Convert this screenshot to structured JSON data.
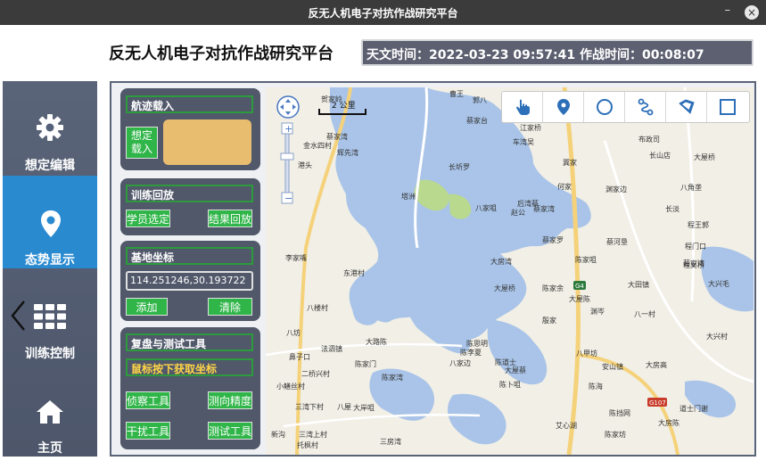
{
  "window": {
    "title": "反无人机电子对抗作战研究平台",
    "minimize": "–",
    "close": "×"
  },
  "header": {
    "title": "反无人机电子对抗作战研究平台",
    "astro_label": "天文时间：",
    "astro_time": "2022-03-23 09:57:41",
    "combat_label": "作战时间：",
    "combat_time": "00:08:07"
  },
  "sidebar": {
    "items": [
      {
        "label": "想定编辑",
        "icon": "gear-icon"
      },
      {
        "label": "态势显示",
        "icon": "location-pin-icon"
      },
      {
        "label": "训练控制",
        "icon": "grid-icon"
      },
      {
        "label": "主页",
        "icon": "home-icon"
      }
    ],
    "active_index": 1
  },
  "panels": {
    "track": {
      "title": "航迹载入",
      "button": "想定\n载入"
    },
    "replay": {
      "title": "训练回放",
      "left_button": "学员选定",
      "right_button": "结果回放"
    },
    "base": {
      "title": "基地坐标",
      "value": "114.251246,30.193722",
      "add_button": "添加",
      "clear_button": "清除"
    },
    "tools": {
      "title": "复盘与测试工具",
      "hint": "鼠标按下获取坐标",
      "btn1": "侦察工具",
      "btn2": "测向精度",
      "btn3": "干扰工具",
      "btn4": "测试工具"
    }
  },
  "map": {
    "scale_label": "2 公里",
    "road_label": "G4",
    "road_label2": "G107",
    "places": [
      "曹王",
      "郭八",
      "贺家岭",
      "蔡家台",
      "江家桥",
      "车湾吴",
      "金水四村",
      "蔡家湾",
      "港头",
      "辉先湾",
      "长圻罗",
      "冀家",
      "布政司",
      "长山店",
      "大屋桥",
      "何家",
      "渊家边",
      "八角垄",
      "塔洲",
      "八家咀",
      "后湾蔡",
      "赵公",
      "蔡家湾",
      "长淡",
      "程王郭",
      "蔡家罗",
      "程门口",
      "蔡河垦",
      "蔡家湾",
      "程吴桥",
      "李家嘴",
      "陈家咀",
      "东港村",
      "大房湾",
      "大田镇",
      "大兴毛",
      "大屋桥",
      "陈家余",
      "大屋陈",
      "八楼村",
      "渊岑",
      "八一村",
      "殷家",
      "法泗镇",
      "大路陈",
      "陈思明",
      "大兴村",
      "陈李夏",
      "八甲坊",
      "八坊",
      "安山镇",
      "大房高",
      "鼻子口",
      "陈家门",
      "八家边",
      "陈道士",
      "二桥兴村",
      "陈家湾",
      "大屋蔡",
      "陈卜咀",
      "陈海",
      "小鳝丝村",
      "八屋",
      "大岸咀",
      "三湾下村",
      "陈挡网",
      "新沟",
      "三湾上村",
      "大房陈",
      "陈家坊",
      "艾心湖",
      "三房湾",
      "道士门谢",
      "托枫村"
    ]
  }
}
